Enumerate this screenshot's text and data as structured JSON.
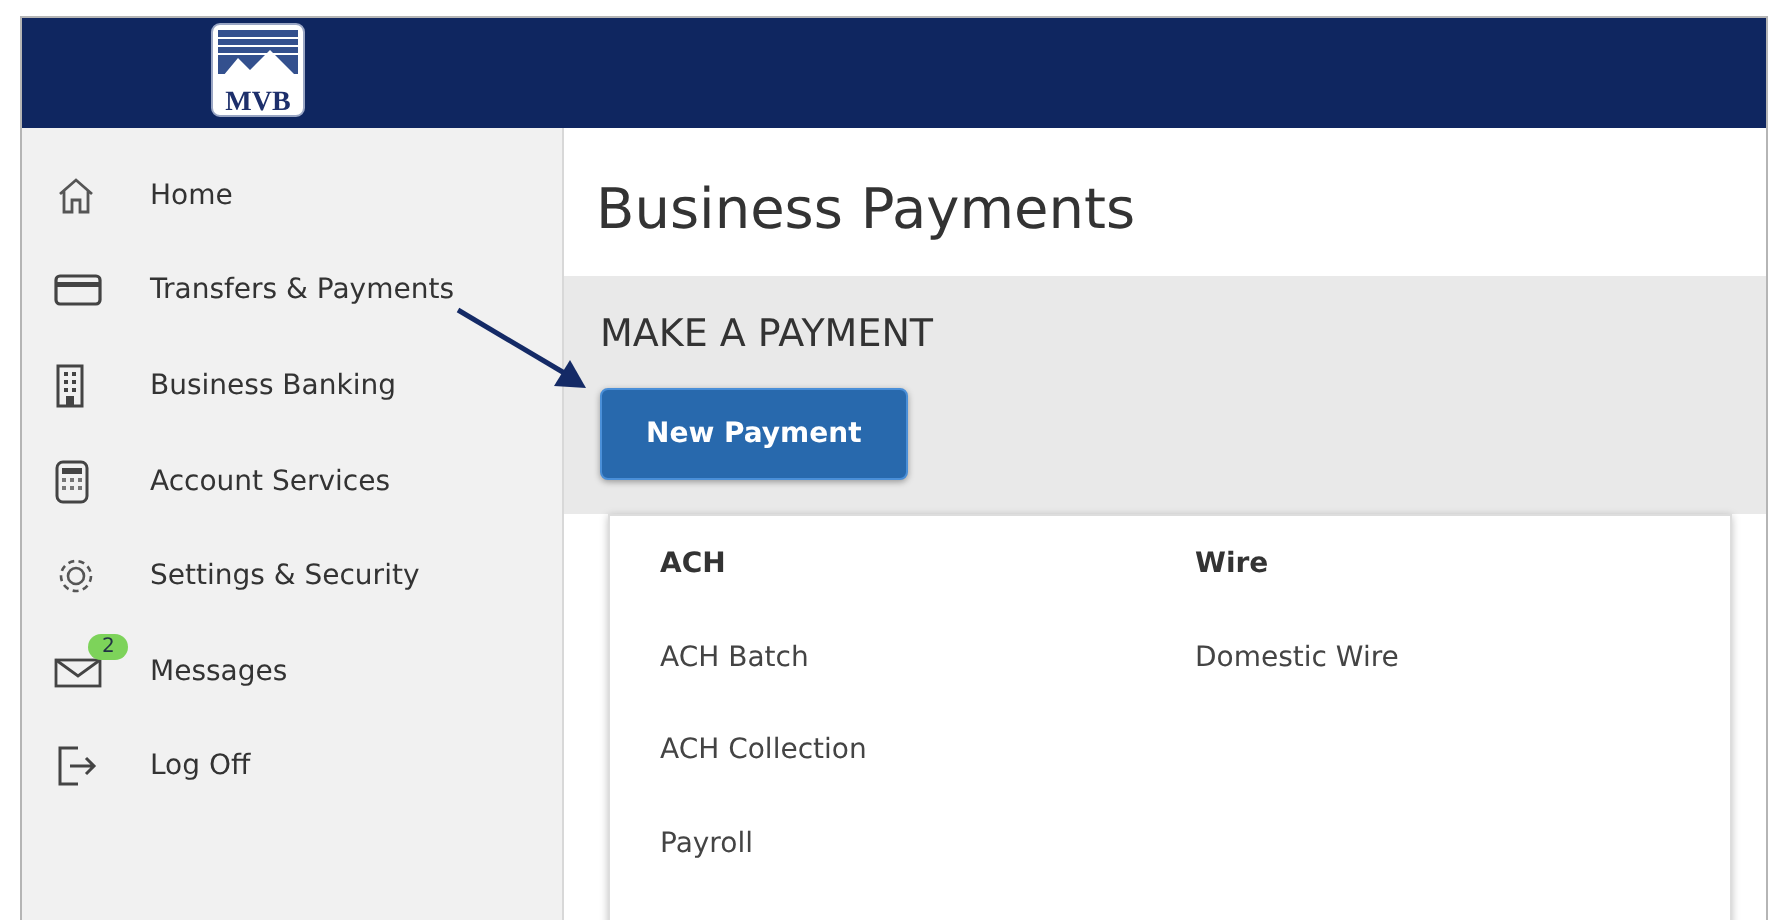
{
  "header": {
    "logo_text": "MVB"
  },
  "sidebar": {
    "items": [
      {
        "kind": "home",
        "label": "Home"
      },
      {
        "kind": "card",
        "label": "Transfers & Payments"
      },
      {
        "kind": "building",
        "label": "Business Banking"
      },
      {
        "kind": "calculator",
        "label": "Account Services"
      },
      {
        "kind": "gear",
        "label": "Settings & Security"
      },
      {
        "kind": "mail",
        "label": "Messages",
        "badge": "2"
      },
      {
        "kind": "logout",
        "label": "Log Off"
      }
    ]
  },
  "main": {
    "title": "Business Payments",
    "section_title": "MAKE A PAYMENT",
    "button": "New Payment",
    "dropdown": {
      "columns": [
        {
          "heading": "ACH",
          "items": [
            "ACH Batch",
            "ACH Collection",
            "Payroll"
          ]
        },
        {
          "heading": "Wire",
          "items": [
            "Domestic Wire"
          ]
        }
      ]
    }
  }
}
